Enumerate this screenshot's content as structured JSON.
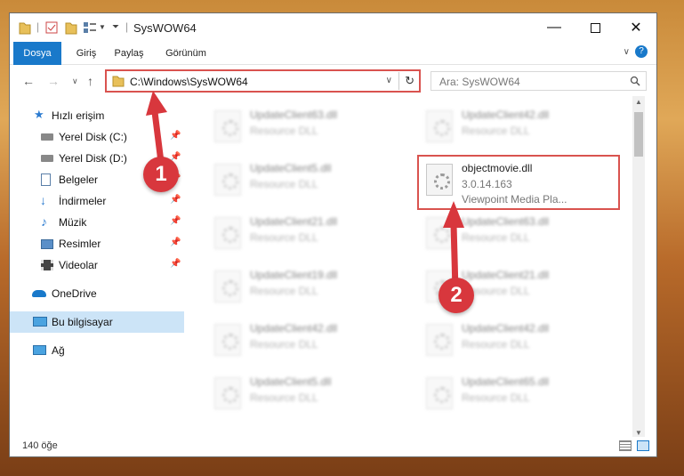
{
  "window": {
    "title": "SysWOW64"
  },
  "ribbon": {
    "tabs": [
      "Dosya",
      "Giriş",
      "Paylaş",
      "Görünüm"
    ]
  },
  "address": {
    "path": "C:\\Windows\\SysWOW64",
    "search_placeholder": "Ara: SysWOW64"
  },
  "sidebar": {
    "items": [
      {
        "label": "Hızlı erişim",
        "icon": "star-icon"
      },
      {
        "label": "Yerel Disk (C:)",
        "icon": "drive-icon",
        "pinned": true
      },
      {
        "label": "Yerel Disk (D:)",
        "icon": "drive-icon",
        "pinned": true
      },
      {
        "label": "Belgeler",
        "icon": "documents-icon",
        "pinned": true
      },
      {
        "label": "İndirmeler",
        "icon": "download-icon",
        "pinned": true
      },
      {
        "label": "Müzik",
        "icon": "music-icon",
        "pinned": true
      },
      {
        "label": "Resimler",
        "icon": "pictures-icon",
        "pinned": true
      },
      {
        "label": "Videolar",
        "icon": "video-icon",
        "pinned": true
      },
      {
        "label": "OneDrive",
        "icon": "cloud-icon"
      },
      {
        "label": "Bu bilgisayar",
        "icon": "computer-icon",
        "selected": true
      },
      {
        "label": "Ağ",
        "icon": "network-icon"
      }
    ]
  },
  "files": {
    "col1": [
      {
        "name": "UpdateClient63.dll",
        "desc": "Resource DLL"
      },
      {
        "name": "UpdateClient5.dll",
        "desc": "Resource DLL"
      },
      {
        "name": "UpdateClient21.dll",
        "desc": "Resource DLL"
      },
      {
        "name": "UpdateClient19.dll",
        "desc": "Resource DLL"
      },
      {
        "name": "UpdateClient42.dll",
        "desc": "Resource DLL"
      },
      {
        "name": "UpdateClient5.dll",
        "desc": "Resource DLL"
      }
    ],
    "col2": [
      {
        "name": "UpdateClient42.dll",
        "desc": "Resource DLL"
      },
      {
        "name": "UpdateClient63.dll",
        "desc": "Resource DLL"
      },
      {
        "name": "UpdateClient21.dll",
        "desc": "Resource DLL"
      },
      {
        "name": "UpdateClient42.dll",
        "desc": "Resource DLL"
      },
      {
        "name": "UpdateClient65.dll",
        "desc": "Resource DLL"
      }
    ],
    "highlighted": {
      "name": "objectmovie.dll",
      "version": "3.0.14.163",
      "company": "Viewpoint Media Pla..."
    }
  },
  "status": {
    "count": "140 öğe"
  },
  "annotations": {
    "badge1": "1",
    "badge2": "2",
    "color": "#d8373d"
  }
}
